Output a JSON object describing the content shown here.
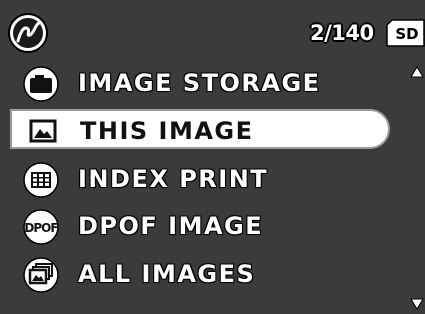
{
  "header": {
    "mode_icon": "no-pen-playback-icon",
    "counter": "2/140",
    "storage_badge": "SD"
  },
  "menu": {
    "items": [
      {
        "label": "IMAGE STORAGE",
        "icon": "camera-icon",
        "selected": false
      },
      {
        "label": "THIS IMAGE",
        "icon": "single-image-icon",
        "selected": true
      },
      {
        "label": "INDEX PRINT",
        "icon": "index-grid-icon",
        "selected": false
      },
      {
        "label": "DPOF IMAGE",
        "icon": "dpof-icon",
        "icon_text": "DPOF",
        "selected": false
      },
      {
        "label": "ALL IMAGES",
        "icon": "multiple-images-icon",
        "selected": false
      }
    ]
  },
  "scroll": {
    "up_icon": "scroll-up-arrow-icon",
    "down_icon": "scroll-down-arrow-icon"
  },
  "colors": {
    "background": "#3b3b3b",
    "highlight": "#ffffff",
    "text": "#ffffff",
    "selected_text": "#111111"
  }
}
